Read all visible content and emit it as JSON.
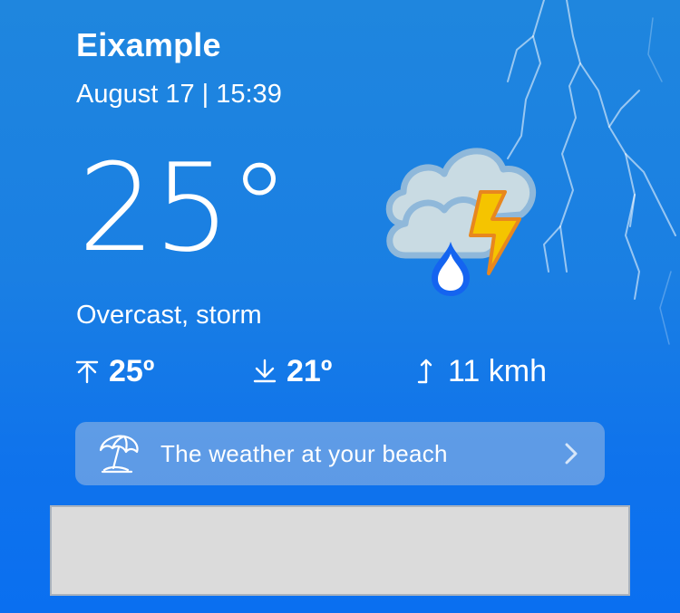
{
  "location": {
    "city": "Eixample",
    "datetime": "August 17 | 15:39"
  },
  "current": {
    "temperature": "25°",
    "condition": "Overcast, storm",
    "icon": "cloud-storm-rain-icon"
  },
  "stats": {
    "max_temp": "25º",
    "min_temp": "21º",
    "wind": "11 kmh",
    "max_icon": "arrow-up-bar-icon",
    "min_icon": "arrow-down-bar-icon",
    "wind_icon": "wind-arrow-icon"
  },
  "beach_banner": {
    "label": "The weather at your beach",
    "icon": "beach-umbrella-icon",
    "chevron": "chevron-right-icon"
  },
  "colors": {
    "background_top": "#1f86de",
    "background_bottom": "#0a6ff0",
    "lightning": "#f5c400",
    "raindrop": "#1464f0",
    "ad_placeholder": "#dbdbdb"
  }
}
